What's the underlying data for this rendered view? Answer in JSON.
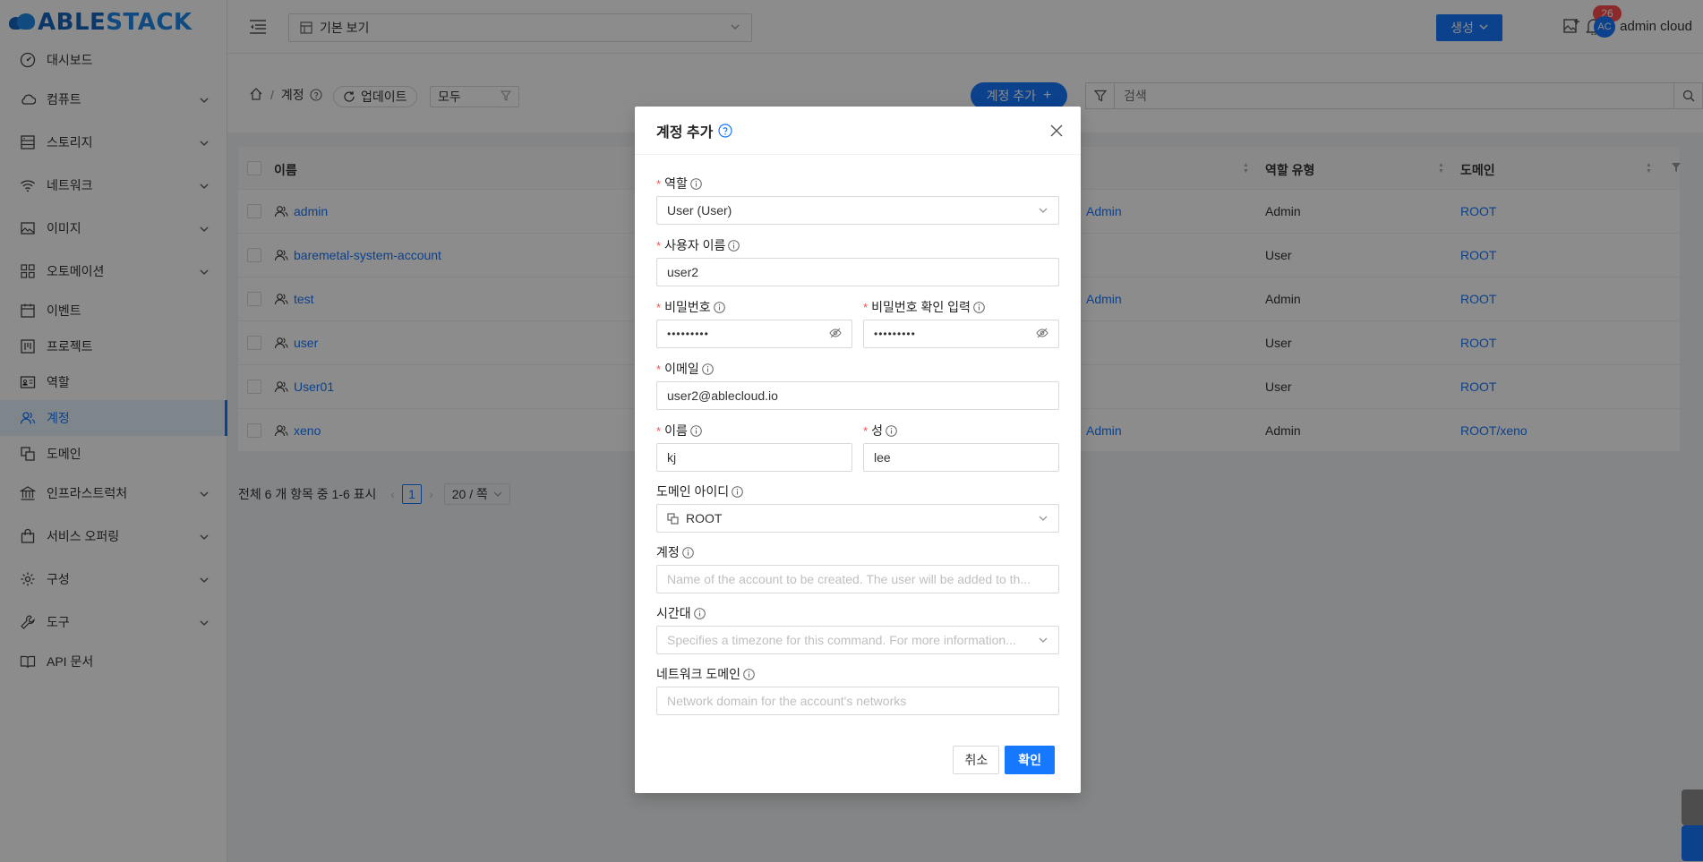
{
  "brand": {
    "part1": "ABLE",
    "part2": "STACK"
  },
  "sidebar": {
    "items": [
      {
        "label": "대시보드",
        "icon": "dashboard-icon",
        "expandable": false
      },
      {
        "label": "컴퓨트",
        "icon": "cloud-icon",
        "expandable": true
      },
      {
        "label": "스토리지",
        "icon": "storage-icon",
        "expandable": true
      },
      {
        "label": "네트워크",
        "icon": "wifi-icon",
        "expandable": true
      },
      {
        "label": "이미지",
        "icon": "image-icon",
        "expandable": true
      },
      {
        "label": "오토메이션",
        "icon": "automation-icon",
        "expandable": true
      },
      {
        "label": "이벤트",
        "icon": "calendar-icon",
        "expandable": false
      },
      {
        "label": "프로젝트",
        "icon": "project-icon",
        "expandable": false
      },
      {
        "label": "역할",
        "icon": "idcard-icon",
        "expandable": false
      },
      {
        "label": "계정",
        "icon": "team-icon",
        "expandable": false,
        "active": true
      },
      {
        "label": "도메인",
        "icon": "domain-icon",
        "expandable": false
      },
      {
        "label": "인프라스트럭처",
        "icon": "bank-icon",
        "expandable": true
      },
      {
        "label": "서비스 오퍼링",
        "icon": "shopping-icon",
        "expandable": true
      },
      {
        "label": "구성",
        "icon": "setting-icon",
        "expandable": true
      },
      {
        "label": "도구",
        "icon": "tool-icon",
        "expandable": true
      },
      {
        "label": "API 문서",
        "icon": "book-icon",
        "expandable": false
      }
    ]
  },
  "header": {
    "view_select": "기본 보기",
    "create_label": "생성",
    "notification_count": "26",
    "avatar_initials": "AC",
    "username": "admin cloud"
  },
  "toolbar": {
    "breadcrumb_current": "계정",
    "refresh_label": "업데이트",
    "filter_value": "모두",
    "add_account_label": "계정 추가",
    "search_placeholder": "검색"
  },
  "table": {
    "headers": {
      "name": "이름",
      "role_type": "역할 유형",
      "domain": "도메인"
    },
    "rows": [
      {
        "name": "admin",
        "role": "Admin",
        "role_type": "Admin",
        "domain": "ROOT"
      },
      {
        "name": "baremetal-system-account",
        "role": "",
        "role_type": "User",
        "domain": "ROOT"
      },
      {
        "name": "test",
        "role": "Admin",
        "role_type": "Admin",
        "domain": "ROOT"
      },
      {
        "name": "user",
        "role": "",
        "role_type": "User",
        "domain": "ROOT"
      },
      {
        "name": "User01",
        "role": "",
        "role_type": "User",
        "domain": "ROOT"
      },
      {
        "name": "xeno",
        "role": "Admin",
        "role_type": "Admin",
        "domain": "ROOT/xeno"
      }
    ]
  },
  "pagination": {
    "summary": "전체 6 개 항목 중 1-6 표시",
    "current_page": "1",
    "page_size": "20 / 쪽"
  },
  "modal": {
    "title": "계정 추가",
    "fields": {
      "role": {
        "label": "역할",
        "value": "User (User)"
      },
      "username": {
        "label": "사용자 이름",
        "value": "user2"
      },
      "password": {
        "label": "비밀번호",
        "value": "•••••••••"
      },
      "password_confirm": {
        "label": "비밀번호 확인 입력",
        "value": "•••••••••"
      },
      "email": {
        "label": "이메일",
        "value": "user2@ablecloud.io"
      },
      "first_name": {
        "label": "이름",
        "value": "kj"
      },
      "last_name": {
        "label": "성",
        "value": "lee"
      },
      "domain_id": {
        "label": "도메인 아이디",
        "value": "ROOT"
      },
      "account": {
        "label": "계정",
        "placeholder": "Name of the account to be created. The user will be added to th..."
      },
      "timezone": {
        "label": "시간대",
        "placeholder": "Specifies a timezone for this command. For more information..."
      },
      "network_domain": {
        "label": "네트워크 도메인",
        "placeholder": "Network domain for the account's networks"
      }
    },
    "cancel_label": "취소",
    "ok_label": "확인"
  },
  "colors": {
    "primary": "#1677ff",
    "danger": "#ff4d4f",
    "mask": "rgba(0,0,0,0.45)"
  }
}
